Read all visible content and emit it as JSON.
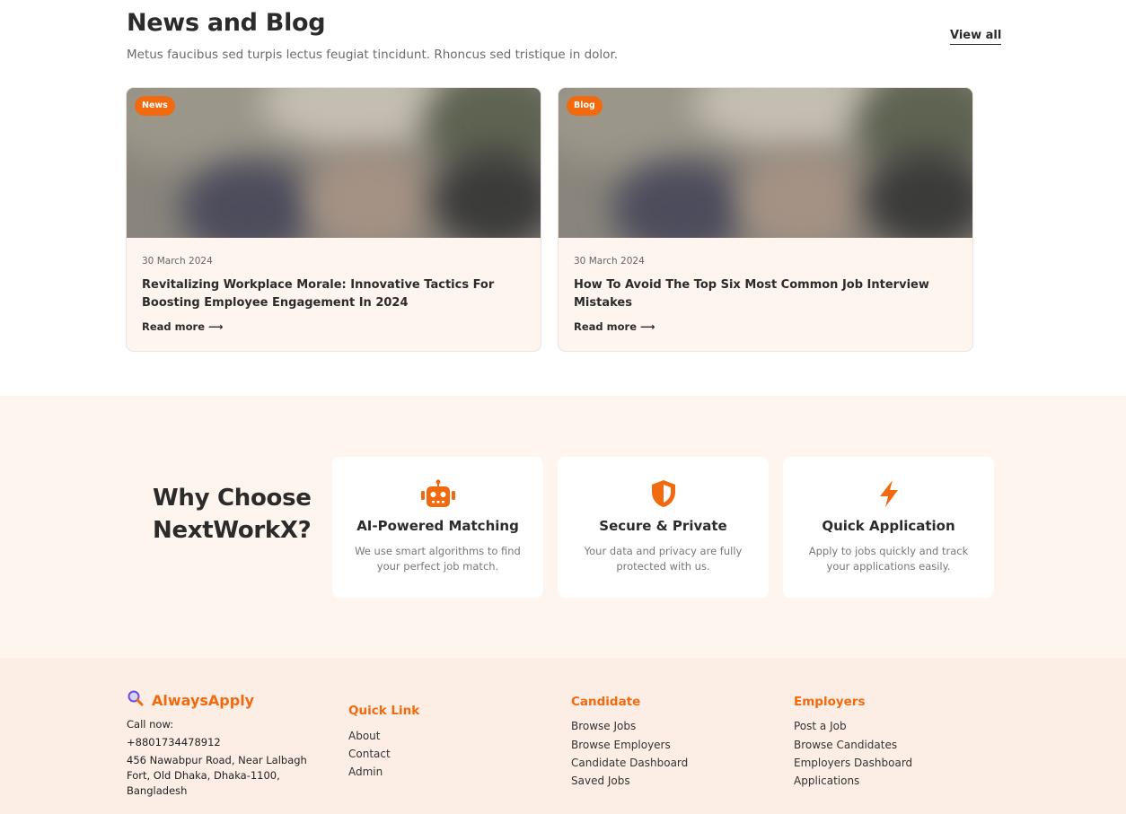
{
  "news": {
    "title": "News and Blog",
    "subtitle": "Metus faucibus sed turpis lectus feugiat tincidunt. Rhoncus sed tristique in dolor.",
    "view_all": "View all",
    "cards": [
      {
        "badge": "News",
        "date": "30 March 2024",
        "title": "Revitalizing Workplace Morale: Innovative Tactics For Boosting Employee Engagement In 2024",
        "read_more": "Read more ⟶"
      },
      {
        "badge": "Blog",
        "date": "30 March 2024",
        "title": "How To Avoid The Top Six Most Common Job Interview Mistakes",
        "read_more": "Read more ⟶"
      }
    ]
  },
  "why": {
    "title_line1": "Why Choose",
    "title_line2": "NextWorkX?",
    "features": [
      {
        "icon": "robot-icon",
        "title": "AI-Powered Matching",
        "desc": "We use smart algorithms to find your perfect job match."
      },
      {
        "icon": "shield-icon",
        "title": "Secure & Private",
        "desc": "Your data and privacy are fully protected with us."
      },
      {
        "icon": "bolt-icon",
        "title": "Quick Application",
        "desc": "Apply to jobs quickly and track your applications easily."
      }
    ]
  },
  "footer": {
    "brand": "AlwaysApply",
    "brand_icon": "search-icon",
    "call_label": "Call now:",
    "phone": "+8801734478912",
    "address": "456 Nawabpur Road, Near Lalbagh Fort, Old Dhaka, Dhaka-1100, Bangladesh",
    "quick_link": {
      "heading": "Quick Link",
      "items": [
        "About",
        "Contact",
        "Admin"
      ]
    },
    "candidate": {
      "heading": "Candidate",
      "items": [
        "Browse Jobs",
        "Browse Employers",
        "Candidate Dashboard",
        "Saved Jobs"
      ]
    },
    "employers": {
      "heading": "Employers",
      "items": [
        "Post a Job",
        "Browse Candidates",
        "Employers Dashboard",
        "Applications"
      ]
    }
  },
  "colors": {
    "accent": "#f26a10",
    "section_bg": "#fff5ef",
    "footer_bg": "#fdeee5"
  }
}
